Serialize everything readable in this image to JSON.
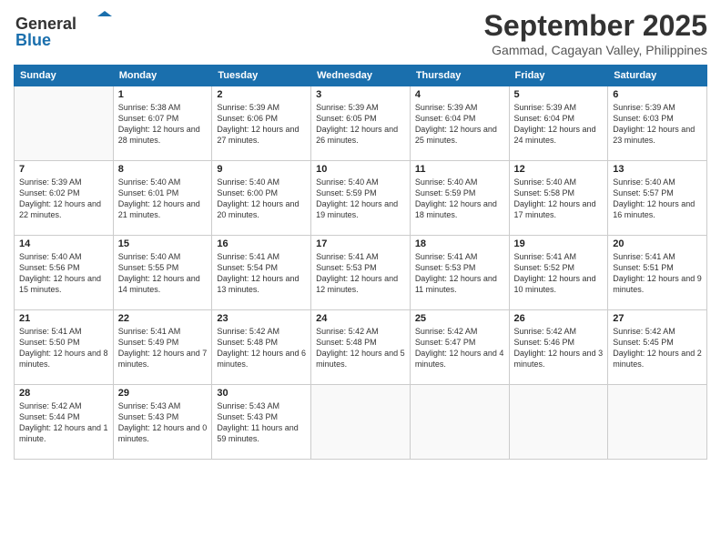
{
  "header": {
    "logo_line1": "General",
    "logo_line2": "Blue",
    "month_title": "September 2025",
    "location": "Gammad, Cagayan Valley, Philippines"
  },
  "days_of_week": [
    "Sunday",
    "Monday",
    "Tuesday",
    "Wednesday",
    "Thursday",
    "Friday",
    "Saturday"
  ],
  "weeks": [
    [
      {
        "day": "",
        "sunrise": "",
        "sunset": "",
        "daylight": ""
      },
      {
        "day": "1",
        "sunrise": "Sunrise: 5:38 AM",
        "sunset": "Sunset: 6:07 PM",
        "daylight": "Daylight: 12 hours and 28 minutes."
      },
      {
        "day": "2",
        "sunrise": "Sunrise: 5:39 AM",
        "sunset": "Sunset: 6:06 PM",
        "daylight": "Daylight: 12 hours and 27 minutes."
      },
      {
        "day": "3",
        "sunrise": "Sunrise: 5:39 AM",
        "sunset": "Sunset: 6:05 PM",
        "daylight": "Daylight: 12 hours and 26 minutes."
      },
      {
        "day": "4",
        "sunrise": "Sunrise: 5:39 AM",
        "sunset": "Sunset: 6:04 PM",
        "daylight": "Daylight: 12 hours and 25 minutes."
      },
      {
        "day": "5",
        "sunrise": "Sunrise: 5:39 AM",
        "sunset": "Sunset: 6:04 PM",
        "daylight": "Daylight: 12 hours and 24 minutes."
      },
      {
        "day": "6",
        "sunrise": "Sunrise: 5:39 AM",
        "sunset": "Sunset: 6:03 PM",
        "daylight": "Daylight: 12 hours and 23 minutes."
      }
    ],
    [
      {
        "day": "7",
        "sunrise": "Sunrise: 5:39 AM",
        "sunset": "Sunset: 6:02 PM",
        "daylight": "Daylight: 12 hours and 22 minutes."
      },
      {
        "day": "8",
        "sunrise": "Sunrise: 5:40 AM",
        "sunset": "Sunset: 6:01 PM",
        "daylight": "Daylight: 12 hours and 21 minutes."
      },
      {
        "day": "9",
        "sunrise": "Sunrise: 5:40 AM",
        "sunset": "Sunset: 6:00 PM",
        "daylight": "Daylight: 12 hours and 20 minutes."
      },
      {
        "day": "10",
        "sunrise": "Sunrise: 5:40 AM",
        "sunset": "Sunset: 5:59 PM",
        "daylight": "Daylight: 12 hours and 19 minutes."
      },
      {
        "day": "11",
        "sunrise": "Sunrise: 5:40 AM",
        "sunset": "Sunset: 5:59 PM",
        "daylight": "Daylight: 12 hours and 18 minutes."
      },
      {
        "day": "12",
        "sunrise": "Sunrise: 5:40 AM",
        "sunset": "Sunset: 5:58 PM",
        "daylight": "Daylight: 12 hours and 17 minutes."
      },
      {
        "day": "13",
        "sunrise": "Sunrise: 5:40 AM",
        "sunset": "Sunset: 5:57 PM",
        "daylight": "Daylight: 12 hours and 16 minutes."
      }
    ],
    [
      {
        "day": "14",
        "sunrise": "Sunrise: 5:40 AM",
        "sunset": "Sunset: 5:56 PM",
        "daylight": "Daylight: 12 hours and 15 minutes."
      },
      {
        "day": "15",
        "sunrise": "Sunrise: 5:40 AM",
        "sunset": "Sunset: 5:55 PM",
        "daylight": "Daylight: 12 hours and 14 minutes."
      },
      {
        "day": "16",
        "sunrise": "Sunrise: 5:41 AM",
        "sunset": "Sunset: 5:54 PM",
        "daylight": "Daylight: 12 hours and 13 minutes."
      },
      {
        "day": "17",
        "sunrise": "Sunrise: 5:41 AM",
        "sunset": "Sunset: 5:53 PM",
        "daylight": "Daylight: 12 hours and 12 minutes."
      },
      {
        "day": "18",
        "sunrise": "Sunrise: 5:41 AM",
        "sunset": "Sunset: 5:53 PM",
        "daylight": "Daylight: 12 hours and 11 minutes."
      },
      {
        "day": "19",
        "sunrise": "Sunrise: 5:41 AM",
        "sunset": "Sunset: 5:52 PM",
        "daylight": "Daylight: 12 hours and 10 minutes."
      },
      {
        "day": "20",
        "sunrise": "Sunrise: 5:41 AM",
        "sunset": "Sunset: 5:51 PM",
        "daylight": "Daylight: 12 hours and 9 minutes."
      }
    ],
    [
      {
        "day": "21",
        "sunrise": "Sunrise: 5:41 AM",
        "sunset": "Sunset: 5:50 PM",
        "daylight": "Daylight: 12 hours and 8 minutes."
      },
      {
        "day": "22",
        "sunrise": "Sunrise: 5:41 AM",
        "sunset": "Sunset: 5:49 PM",
        "daylight": "Daylight: 12 hours and 7 minutes."
      },
      {
        "day": "23",
        "sunrise": "Sunrise: 5:42 AM",
        "sunset": "Sunset: 5:48 PM",
        "daylight": "Daylight: 12 hours and 6 minutes."
      },
      {
        "day": "24",
        "sunrise": "Sunrise: 5:42 AM",
        "sunset": "Sunset: 5:48 PM",
        "daylight": "Daylight: 12 hours and 5 minutes."
      },
      {
        "day": "25",
        "sunrise": "Sunrise: 5:42 AM",
        "sunset": "Sunset: 5:47 PM",
        "daylight": "Daylight: 12 hours and 4 minutes."
      },
      {
        "day": "26",
        "sunrise": "Sunrise: 5:42 AM",
        "sunset": "Sunset: 5:46 PM",
        "daylight": "Daylight: 12 hours and 3 minutes."
      },
      {
        "day": "27",
        "sunrise": "Sunrise: 5:42 AM",
        "sunset": "Sunset: 5:45 PM",
        "daylight": "Daylight: 12 hours and 2 minutes."
      }
    ],
    [
      {
        "day": "28",
        "sunrise": "Sunrise: 5:42 AM",
        "sunset": "Sunset: 5:44 PM",
        "daylight": "Daylight: 12 hours and 1 minute."
      },
      {
        "day": "29",
        "sunrise": "Sunrise: 5:43 AM",
        "sunset": "Sunset: 5:43 PM",
        "daylight": "Daylight: 12 hours and 0 minutes."
      },
      {
        "day": "30",
        "sunrise": "Sunrise: 5:43 AM",
        "sunset": "Sunset: 5:43 PM",
        "daylight": "Daylight: 11 hours and 59 minutes."
      },
      {
        "day": "",
        "sunrise": "",
        "sunset": "",
        "daylight": ""
      },
      {
        "day": "",
        "sunrise": "",
        "sunset": "",
        "daylight": ""
      },
      {
        "day": "",
        "sunrise": "",
        "sunset": "",
        "daylight": ""
      },
      {
        "day": "",
        "sunrise": "",
        "sunset": "",
        "daylight": ""
      }
    ]
  ]
}
